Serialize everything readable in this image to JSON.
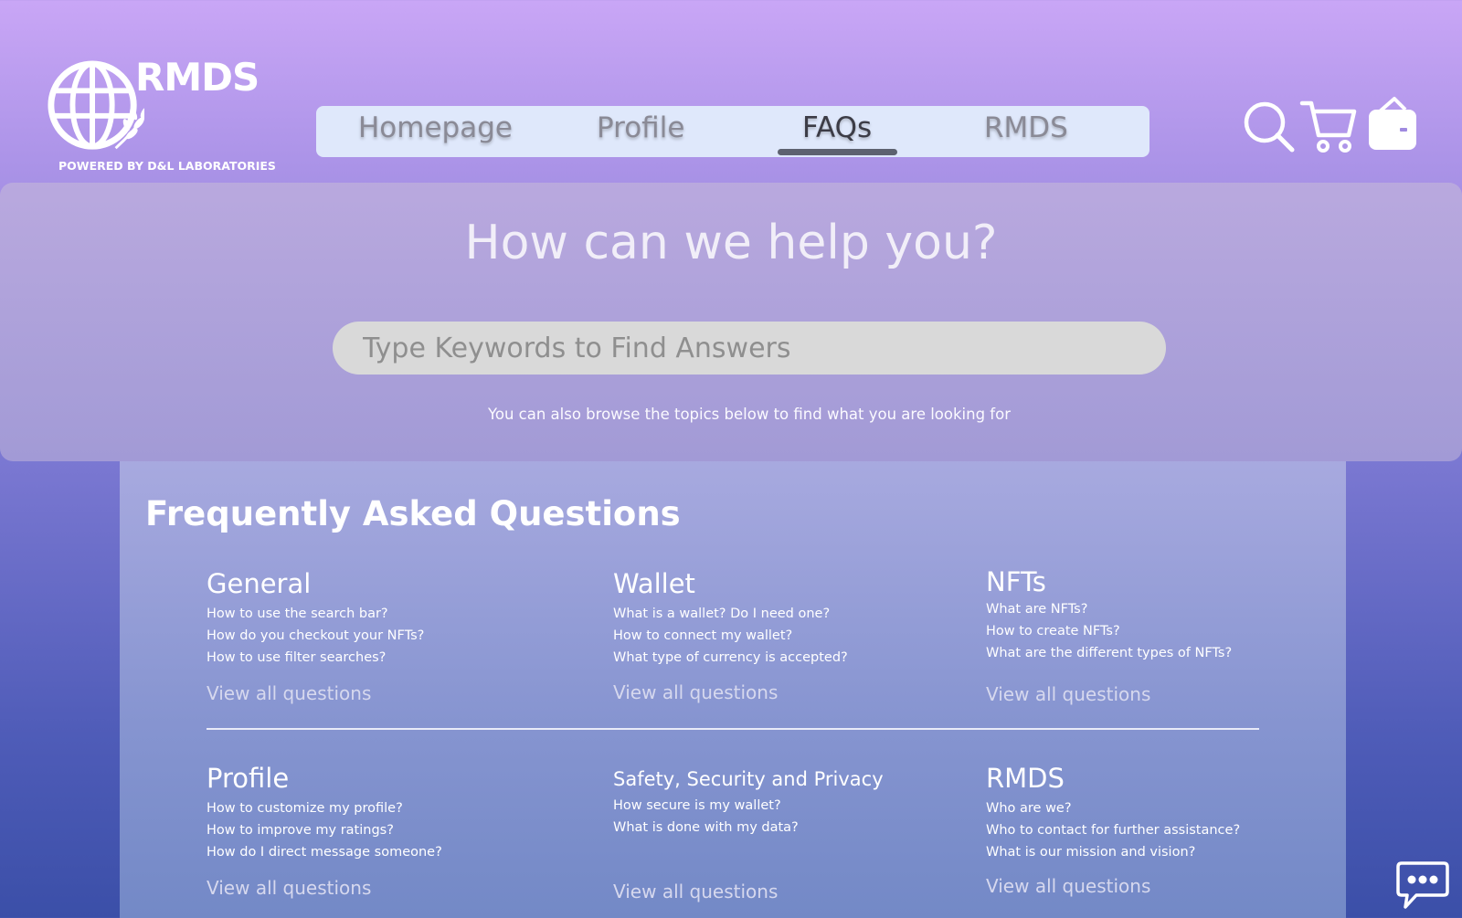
{
  "brand": {
    "name": "RMDS",
    "tagline": "POWERED BY D&L LABORATORIES"
  },
  "nav": {
    "items": [
      {
        "label": "Homepage"
      },
      {
        "label": "Profile"
      },
      {
        "label": "FAQs",
        "active": true
      },
      {
        "label": "RMDS"
      }
    ]
  },
  "header_icons": [
    "search-icon",
    "cart-icon",
    "wallet-icon"
  ],
  "hero": {
    "title": "How can we help you?",
    "search_placeholder": "Type Keywords to Find Answers",
    "subtitle": "You can also browse the topics below to find what you are looking for"
  },
  "faq": {
    "heading": "Frequently Asked Questions",
    "view_all_label": "View all questions",
    "categories": [
      {
        "title": "General",
        "questions": [
          "How to use the search bar?",
          "How do you checkout your NFTs?",
          "How to use filter searches?"
        ]
      },
      {
        "title": "Wallet",
        "questions": [
          "What is a wallet? Do I need one?",
          "How to connect my wallet?",
          "What type of currency is accepted?"
        ]
      },
      {
        "title": "NFTs",
        "questions": [
          "What are NFTs?",
          "How to create NFTs?",
          "What are the different types of NFTs?"
        ]
      },
      {
        "title": "Profile",
        "questions": [
          "How to customize my profile?",
          "How to improve my ratings?",
          "How do I direct message someone?"
        ]
      },
      {
        "title": "Safety, Security and Privacy",
        "questions": [
          "How secure is my wallet?",
          "What is done with my data?"
        ]
      },
      {
        "title": "RMDS",
        "questions": [
          "Who are we?",
          "Who to contact for further assistance?",
          "What is our mission and vision?"
        ]
      }
    ]
  },
  "colors": {
    "nav_bg": "#dfe8fb",
    "nav_active": "#3c3c46",
    "search_bg": "#d9d9d9"
  },
  "chat_icon": "chat-bubble-icon"
}
